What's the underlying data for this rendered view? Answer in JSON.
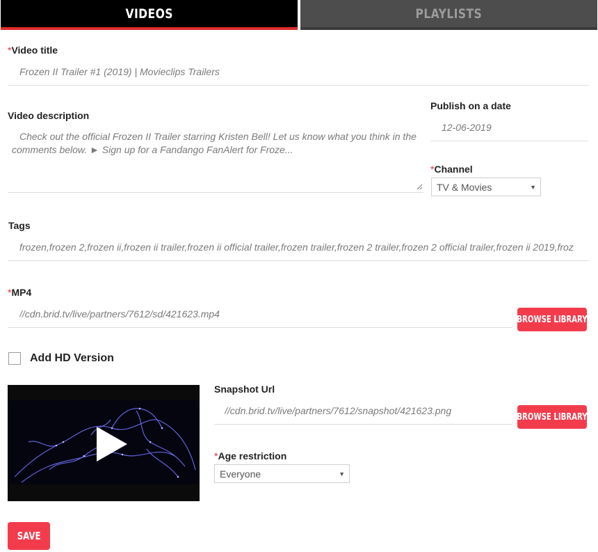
{
  "tabs": {
    "videos": "VIDEOS",
    "playlists": "PLAYLISTS"
  },
  "required_mark": "*",
  "video_title": {
    "label": "Video title",
    "value": "Frozen II Trailer #1 (2019) | Movieclips Trailers"
  },
  "video_description": {
    "label": "Video description",
    "line1": "Check out the official Frozen II Trailer starring Kristen Bell! Let us know what you think in the",
    "line2": "comments below. ► Sign up for a Fandango FanAlert for Froze..."
  },
  "publish": {
    "label": "Publish on a date",
    "value": "12-06-2019"
  },
  "channel": {
    "label": "Channel",
    "selected": "TV & Movies"
  },
  "tags": {
    "label": "Tags",
    "value": "frozen,frozen 2,frozen ii,frozen ii trailer,frozen ii official trailer,frozen trailer,frozen 2 trailer,frozen 2 official trailer,frozen ii 2019,froz"
  },
  "mp4": {
    "label": "MP4",
    "value": "//cdn.brid.tv/live/partners/7612/sd/421623.mp4",
    "browse": "BROWSE LIBRARY"
  },
  "hd": {
    "label": "Add HD Version",
    "checked": false
  },
  "snapshot": {
    "label": "Snapshot Url",
    "value": "//cdn.brid.tv/live/partners/7612/snapshot/421623.png",
    "browse": "BROWSE LIBRARY"
  },
  "age": {
    "label": "Age restriction",
    "selected": "Everyone"
  },
  "save": "SAVE",
  "icons": {
    "play": "play-icon",
    "dropdown": "chevron-down-icon"
  },
  "colors": {
    "accent": "#f23c4c",
    "tab_active_bg": "#000000",
    "tab_inactive_bg": "#4d4d4d",
    "tab_underline": "#e02a2a"
  }
}
